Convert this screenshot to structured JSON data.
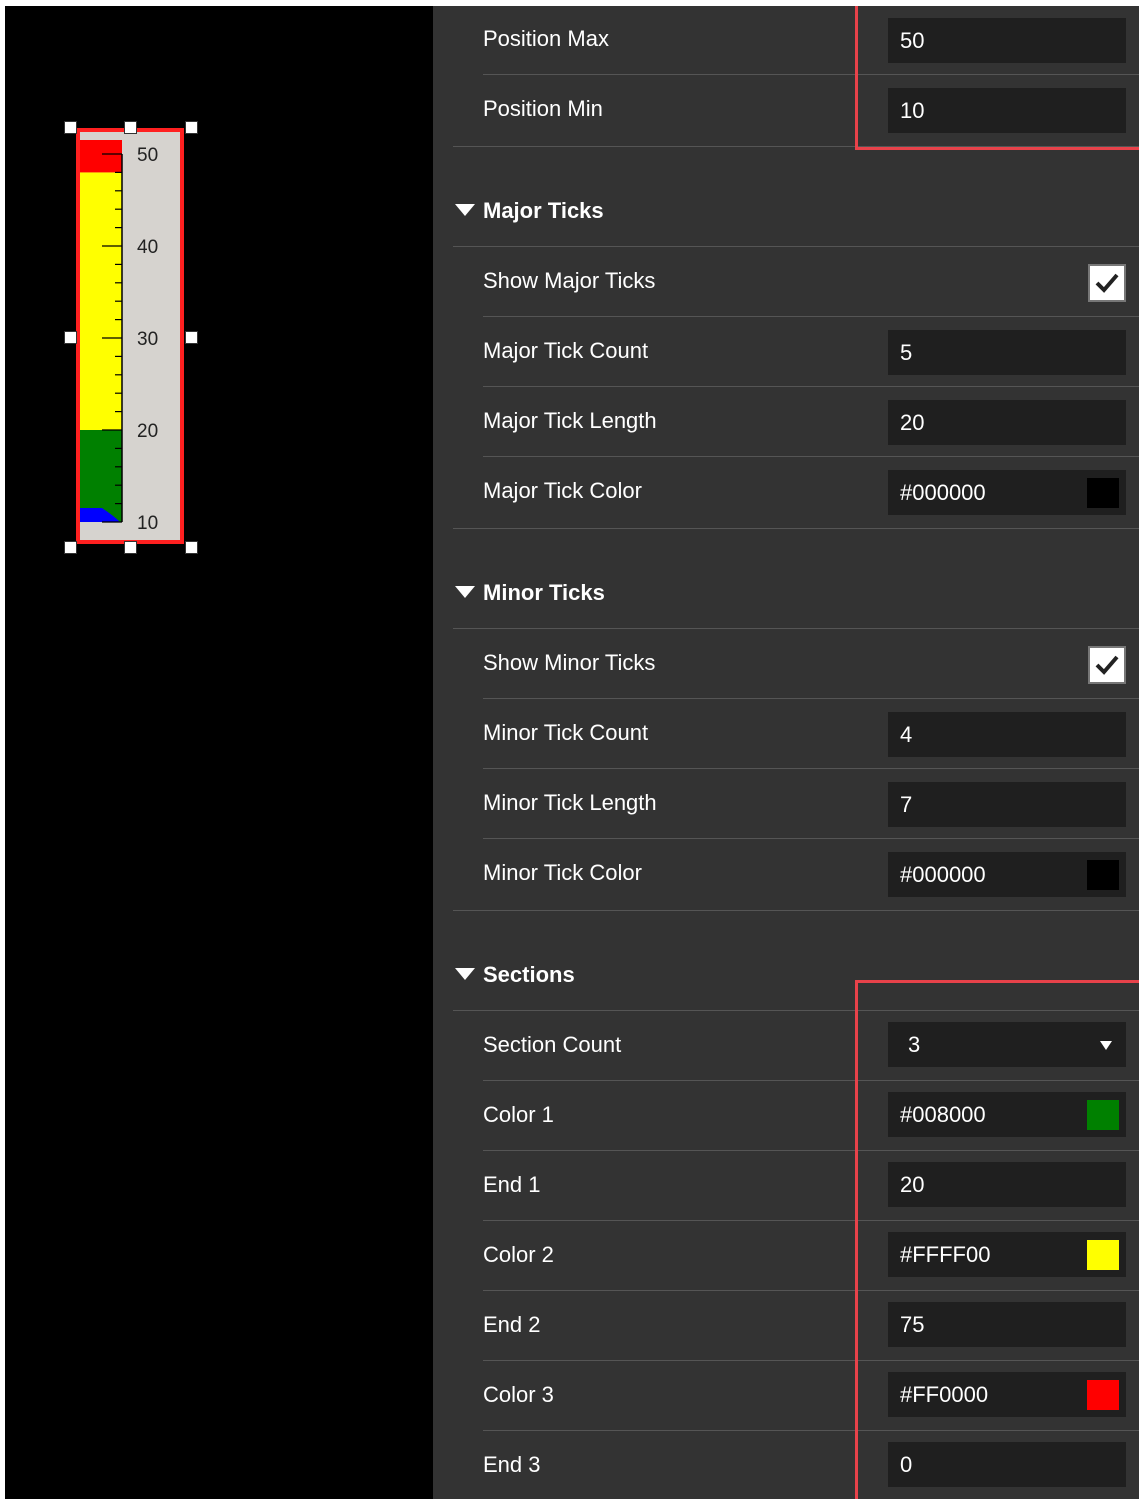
{
  "gauge": {
    "scale_labels": [
      "50",
      "40",
      "30",
      "20",
      "10"
    ],
    "fill_color": "#0000ff",
    "sections": [
      {
        "color": "#008000",
        "from": 10,
        "to": 20
      },
      {
        "color": "#FFFF00",
        "from": 20,
        "to": 48
      },
      {
        "color": "#FF0000",
        "from": 48,
        "to": 50
      }
    ],
    "min": 10,
    "max": 50,
    "major_tick_count": 5,
    "minor_tick_count": 4
  },
  "position": {
    "max_label": "Position Max",
    "max_value": "50",
    "min_label": "Position Min",
    "min_value": "10"
  },
  "major_ticks": {
    "header": "Major Ticks",
    "show_label": "Show Major Ticks",
    "show_checked": true,
    "count_label": "Major Tick Count",
    "count_value": "5",
    "length_label": "Major Tick Length",
    "length_value": "20",
    "color_label": "Major Tick Color",
    "color_value": "#000000",
    "color": "#000000"
  },
  "minor_ticks": {
    "header": "Minor Ticks",
    "show_label": "Show Minor Ticks",
    "show_checked": true,
    "count_label": "Minor Tick Count",
    "count_value": "4",
    "length_label": "Minor Tick Length",
    "length_value": "7",
    "color_label": "Minor Tick Color",
    "color_value": "#000000",
    "color": "#000000"
  },
  "sections": {
    "header": "Sections",
    "count_label": "Section Count",
    "count_value": "3",
    "color1_label": "Color 1",
    "color1_value": "#008000",
    "color1": "#008000",
    "end1_label": "End 1",
    "end1_value": "20",
    "color2_label": "Color 2",
    "color2_value": "#FFFF00",
    "color2": "#FFFF00",
    "end2_label": "End 2",
    "end2_value": "75",
    "color3_label": "Color 3",
    "color3_value": "#FF0000",
    "color3": "#FF0000",
    "end3_label": "End 3",
    "end3_value": "0"
  },
  "highlight_color": "#e8424a"
}
